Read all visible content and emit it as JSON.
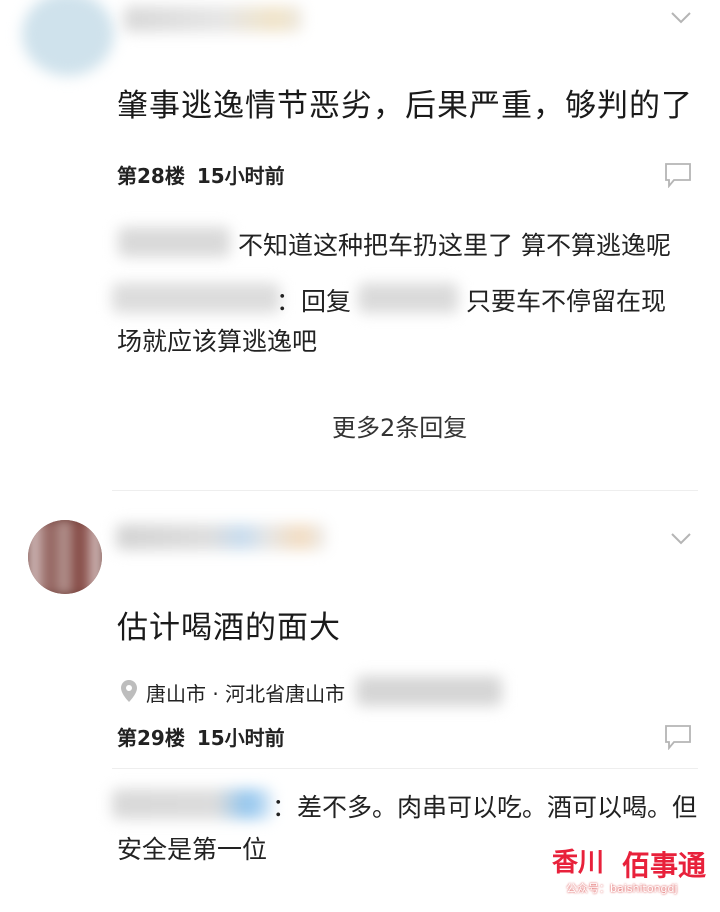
{
  "comment1": {
    "text": "肇事逃逸情节恶劣，后果严重，够判的了",
    "floor": "第28楼",
    "time": "15小时前",
    "replies": [
      {
        "text": "不知道这种把车扔这里了 算不算逃逸呢"
      },
      {
        "prefix": "：回复",
        "suffix": "只要车不停留在现",
        "cont": "场就应该算逃逸吧"
      }
    ],
    "more_replies": "更多2条回复"
  },
  "comment2": {
    "text": "估计喝酒的面大",
    "location": "唐山市 · 河北省唐山市",
    "floor": "第29楼",
    "time": "15小时前",
    "reply": {
      "line1": "：差不多。肉串可以吃。酒可以喝。但",
      "line2": "安全是第一位"
    }
  },
  "watermark": {
    "brand": "佰事通",
    "sub": "公众号：baishitongdj"
  },
  "icons": {
    "chevron": "chevron-down-icon",
    "comment": "comment-icon",
    "location": "location-pin-icon"
  }
}
